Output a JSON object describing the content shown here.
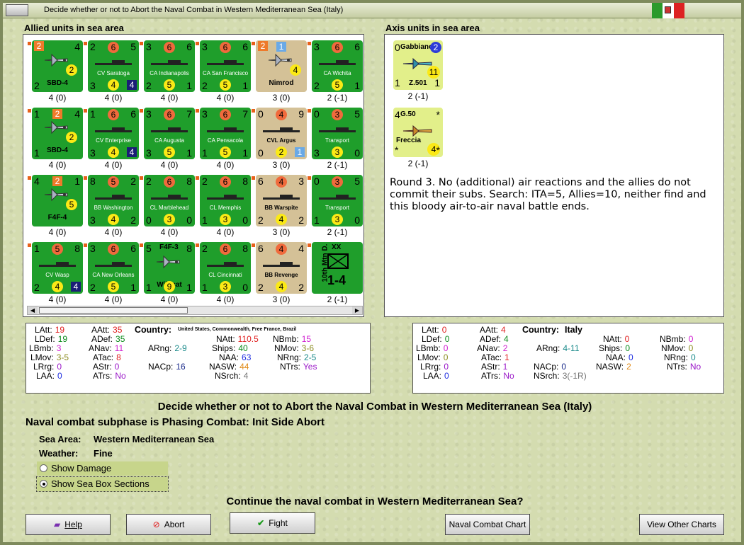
{
  "window": {
    "title": "Decide whether or not to Abort the Naval Combat in Western Mediterranean Sea (Italy)"
  },
  "panels": {
    "allied_title": "Allied units in sea area",
    "axis_title": "Axis units in sea area"
  },
  "allied_units": [
    {
      "kind": "air",
      "tl": "2",
      "tlbox": "o",
      "tr": "4",
      "c": "2",
      "bl": "2",
      "name": "SBD-4",
      "cap": "4 (0)"
    },
    {
      "kind": "ship",
      "tl": "2",
      "tc": "6",
      "tr": "5",
      "bl": "3",
      "bc": "4",
      "br": "4",
      "brbox": "nv",
      "name": "CV Saratoga",
      "cap": "4 (0)"
    },
    {
      "kind": "ship",
      "tl": "3",
      "tc": "6",
      "tr": "6",
      "bl": "2",
      "bc": "5",
      "br": "1",
      "name": "CA Indianapolis",
      "cap": "4 (0)"
    },
    {
      "kind": "ship",
      "tl": "3",
      "tc": "6",
      "tr": "6",
      "bl": "2",
      "bc": "5",
      "br": "1",
      "name": "CA San Francisco",
      "cap": "4 (0)"
    },
    {
      "kind": "air",
      "tan": true,
      "tl": "2",
      "tlbox": "o",
      "tc": "1",
      "tcbox": "lb",
      "c": "4",
      "name": "Nimrod",
      "cap": "3 (0)"
    },
    {
      "kind": "ship",
      "tl": "3",
      "tc": "6",
      "tr": "6",
      "bl": "2",
      "bc": "5",
      "br": "1",
      "name": "CA Wichita",
      "cap": "2 (-1)"
    },
    {
      "kind": "air",
      "tl": "1",
      "tc": "2",
      "tcbox": "o",
      "tr": "4",
      "c": "2",
      "bl": "1",
      "name": "SBD-4",
      "cap": "4 (0)"
    },
    {
      "kind": "ship",
      "tl": "1",
      "tc": "6",
      "tr": "6",
      "bl": "3",
      "bc": "4",
      "br": "4",
      "brbox": "nv",
      "name": "CV Enterprise",
      "cap": "4 (0)"
    },
    {
      "kind": "ship",
      "tl": "3",
      "tc": "6",
      "tr": "7",
      "bl": "3",
      "bc": "5",
      "br": "1",
      "name": "CA Augusta",
      "cap": "4 (0)"
    },
    {
      "kind": "ship",
      "tl": "3",
      "tc": "6",
      "tr": "7",
      "bl": "1",
      "bc": "5",
      "br": "1",
      "name": "CA Pensacola",
      "cap": "4 (0)"
    },
    {
      "kind": "ship",
      "tan": true,
      "tl": "0",
      "tc": "4",
      "tr": "9",
      "bl": "0",
      "bc": "2",
      "br": "1",
      "brbox": "lb",
      "name": "CVL Argus",
      "cap": "3 (0)"
    },
    {
      "kind": "ship",
      "tl": "0",
      "tc": "3",
      "tr": "5",
      "bl": "3",
      "bc": "3",
      "br": "0",
      "name": "Transport",
      "cap": "2 (-1)"
    },
    {
      "kind": "air",
      "tl": "4",
      "tc": "2",
      "tcbox": "o",
      "tr": "1",
      "c": "5",
      "name": "F4F-4",
      "cap": "4 (0)"
    },
    {
      "kind": "ship",
      "tl": "8",
      "tc": "5",
      "tr": "2",
      "bl": "3",
      "bc": "4",
      "br": "2",
      "name": "BB Washington",
      "cap": "4 (0)"
    },
    {
      "kind": "ship",
      "tl": "2",
      "tc": "6",
      "tr": "8",
      "bl": "0",
      "bc": "3",
      "br": "0",
      "name": "CL Marblehead",
      "cap": "4 (0)"
    },
    {
      "kind": "ship",
      "tl": "2",
      "tc": "6",
      "tr": "8",
      "bl": "1",
      "bc": "3",
      "br": "0",
      "name": "CL Memphis",
      "cap": "4 (0)"
    },
    {
      "kind": "ship",
      "tan": true,
      "tl": "6",
      "tc": "4",
      "tr": "3",
      "bl": "2",
      "bc": "4",
      "br": "2",
      "name": "BB Warspite",
      "cap": "3 (0)"
    },
    {
      "kind": "ship",
      "tl": "0",
      "tc": "3",
      "tr": "5",
      "bl": "1",
      "bc": "3",
      "br": "0",
      "name": "Transport",
      "cap": "2 (-1)"
    },
    {
      "kind": "ship",
      "tl": "1",
      "tc": "5",
      "tr": "8",
      "bl": "2",
      "bc": "4",
      "br": "4",
      "brbox": "nv",
      "name": "CV Wasp",
      "cap": "4 (0)"
    },
    {
      "kind": "ship",
      "tl": "3",
      "tc": "6",
      "tr": "6",
      "bl": "2",
      "bc": "5",
      "br": "1",
      "name": "CA New Orleans",
      "cap": "4 (0)"
    },
    {
      "kind": "air",
      "tl": "5",
      "tc": "F4F-3",
      "tr": "8",
      "bl": "1",
      "bc": "9",
      "br": "1",
      "name": "Wildcat",
      "cap": "4 (0)"
    },
    {
      "kind": "ship",
      "tl": "2",
      "tc": "6",
      "tr": "8",
      "bl": "1",
      "bc": "3",
      "br": "0",
      "name": "CL Cincinnati",
      "cap": "4 (0)"
    },
    {
      "kind": "ship",
      "tan": true,
      "tl": "6",
      "tc": "4",
      "tr": "4",
      "bl": "2",
      "bc": "4",
      "br": "2",
      "name": "BB Revenge",
      "cap": "3 (0)"
    },
    {
      "kind": "land",
      "side": "10th Mtn D.",
      "xx": "XX",
      "str": "1-4",
      "cap": "2 (-1)"
    }
  ],
  "axis_units": [
    {
      "tl": "0",
      "name": "Gabbiano",
      "tr": "2",
      "c": "11",
      "bl": "1",
      "bn": "Z.501",
      "br": "1",
      "cap": "2 (-1)"
    },
    {
      "tl": "4",
      "name": "G.50",
      "tr": "*",
      "bn": "Freccia",
      "c": "4",
      "bl": "*",
      "br": "*",
      "cap": "2 (-1)"
    }
  ],
  "round_text": "Round 3.  No (additional) air reactions and the allies do not commit their subs.  Search:  ITA=5, Allies=10, neither find and this bloody air-to-air  naval battle ends.",
  "allied_stats": {
    "country_label": "Country:",
    "country": "United States, Commonwealth, Free France, Brazil",
    "LAtt": "19",
    "LDef": "19",
    "LBmb": "3",
    "LMov": "3-5",
    "LRrg": "0",
    "LAA": "0",
    "AAtt": "35",
    "ADef": "35",
    "ANav": "11",
    "ATac": "8",
    "AStr": "0",
    "ATrs": "No",
    "ARng": "2-9",
    "NACp": "16",
    "Ships": "40",
    "NAA": "63",
    "NASW": "44",
    "NSrch": "4",
    "NAtt": "110.5",
    "NBmb": "15",
    "NMov": "3-6",
    "NRng": "2-5",
    "NTrs": "Yes"
  },
  "axis_stats": {
    "country_label": "Country:",
    "country": "Italy",
    "LAtt": "0",
    "LDef": "0",
    "LBmb": "0",
    "LMov": "0",
    "LRrg": "0",
    "LAA": "0",
    "AAtt": "4",
    "ADef": "4",
    "ANav": "2",
    "ATac": "1",
    "AStr": "1",
    "ATrs": "No",
    "ARng": "4-11",
    "NACp": "0",
    "NSrch": "3(-1R)",
    "NAtt": "0",
    "Ships": "0",
    "NAA": "0",
    "NASW": "2",
    "NBmb": "0",
    "NMov": "0",
    "NRng": "0",
    "NTrs": "No"
  },
  "main": {
    "heading": "Decide whether or not to Abort the Naval Combat in Western Mediterranean Sea (Italy)",
    "subphase": "Naval combat subphase is Phasing Combat: Init Side Abort",
    "sea_area_label": "Sea Area:",
    "sea_area": "Western Mediterranean Sea",
    "weather_label": "Weather:",
    "weather": "Fine",
    "show_damage": "Show Damage",
    "show_sections": "Show Sea Box Sections",
    "question": "Continue the naval combat in Western Mediterranean Sea?"
  },
  "buttons": {
    "help": "Help",
    "abort": "Abort",
    "fight": "Fight",
    "naval_chart": "Naval Combat Chart",
    "other_charts": "View Other Charts"
  },
  "colors": {
    "counter_green": "#1f9e2b",
    "counter_tan": "#d4c197",
    "axis_yellow": "#e2ef8a",
    "background": "#d4dcb0"
  }
}
